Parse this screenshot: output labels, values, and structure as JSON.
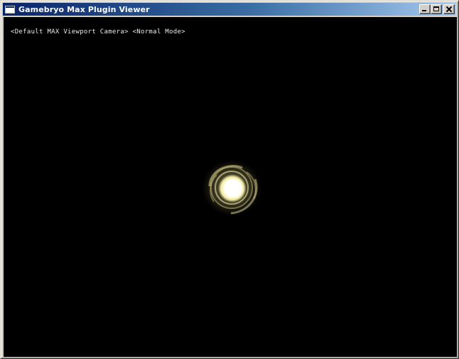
{
  "window": {
    "title": "Gamebryo Max Plugin Viewer",
    "buttons": {
      "minimize": "minimize",
      "maximize": "maximize",
      "close": "close"
    }
  },
  "viewport": {
    "camera_label": "<Default MAX Viewport Camera> <Normal Mode>"
  },
  "colors": {
    "background": "#000000",
    "glow_core": "#fffde0",
    "glow_halo": "#d8cf8a",
    "titlebar_start": "#0a246a",
    "titlebar_end": "#a6caf0"
  }
}
